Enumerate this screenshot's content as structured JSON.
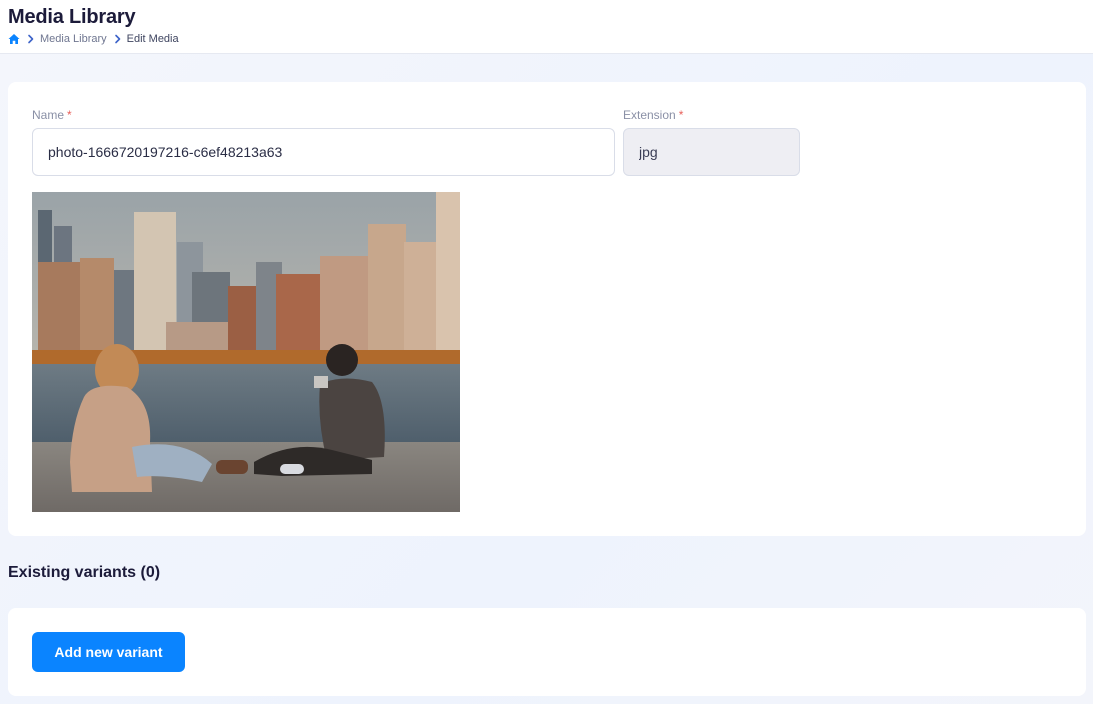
{
  "header": {
    "title": "Media Library",
    "breadcrumb": {
      "home_icon": "home-icon",
      "separator_icon": "chevron-right-icon",
      "items": [
        "Media Library",
        "Edit Media"
      ]
    }
  },
  "form": {
    "name_label": "Name",
    "name_required": "*",
    "name_value": "photo-1666720197216-c6ef48213a63",
    "extension_label": "Extension",
    "extension_required": "*",
    "extension_value": "jpg"
  },
  "variants": {
    "title": "Existing variants (0)",
    "add_button_label": "Add new variant"
  },
  "colors": {
    "accent": "#0a84ff",
    "title_text": "#1c1b3a",
    "required_marker": "#e8605a"
  }
}
